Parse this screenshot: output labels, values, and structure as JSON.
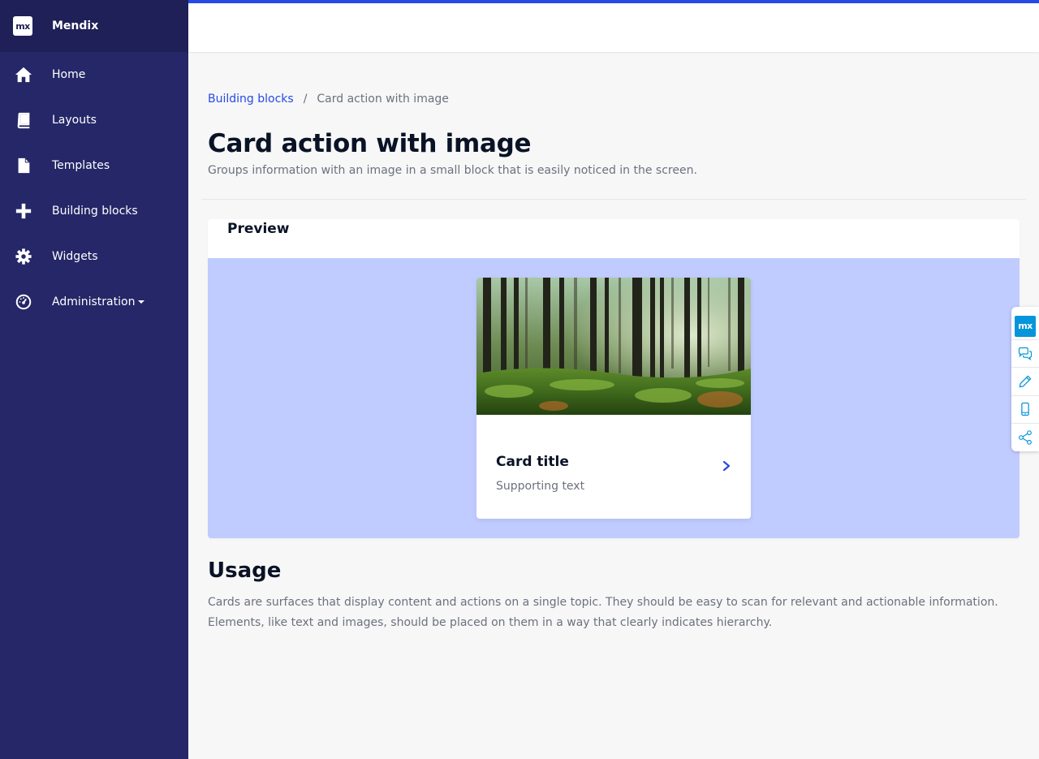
{
  "sidebar": {
    "brand": {
      "logo_text": "mx",
      "name": "Mendix"
    },
    "items": [
      {
        "label": "Home",
        "icon": "home-icon"
      },
      {
        "label": "Layouts",
        "icon": "book-icon"
      },
      {
        "label": "Templates",
        "icon": "document-icon"
      },
      {
        "label": "Building blocks",
        "icon": "plus-icon"
      },
      {
        "label": "Widgets",
        "icon": "gear-icon"
      },
      {
        "label": "Administration",
        "icon": "dashboard-icon",
        "has_dropdown": true
      }
    ]
  },
  "breadcrumb": {
    "parent": "Building blocks",
    "separator": "/",
    "current": "Card action with image"
  },
  "page": {
    "title": "Card action with image",
    "subtitle": "Groups information with an image in a small block that is easily noticed in the screen."
  },
  "preview": {
    "heading": "Preview",
    "card": {
      "image": "forest-image",
      "title": "Card title",
      "text": "Supporting text",
      "action_icon": "chevron-right-icon"
    }
  },
  "usage": {
    "heading": "Usage",
    "text": "Cards are surfaces that display content and actions on a single topic. They should be easy to scan for relevant and actionable information. Elements, like text and images, should be placed on them in a way that clearly indicates hierarchy."
  },
  "dock": {
    "logo_text": "mx",
    "items": [
      "chat-icon",
      "pencil-icon",
      "mobile-icon",
      "share-icon"
    ]
  },
  "colors": {
    "sidebar": "#252768",
    "brand_bar": "#1f2057",
    "accent": "#264ae5",
    "preview_bg": "#c0cbff",
    "dock_accent": "#0595db"
  }
}
